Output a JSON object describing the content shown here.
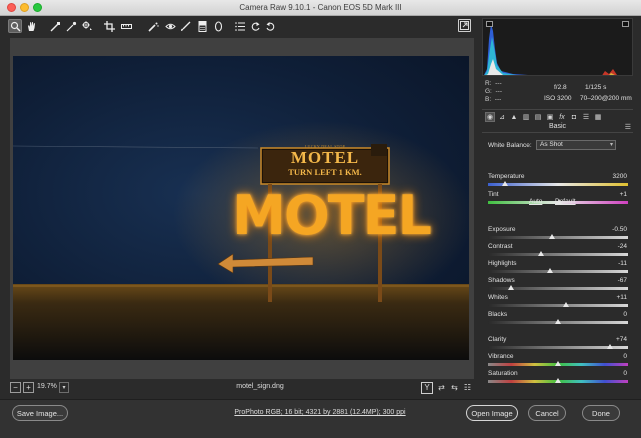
{
  "window": {
    "title": "Camera Raw 9.10.1  -  Canon EOS 5D Mark III"
  },
  "toolbar": {
    "tools": [
      "zoom-tool-icon",
      "hand-tool-icon",
      "white-balance-tool-icon",
      "color-sampler-icon",
      "targeted-adjustment-icon",
      "crop-tool-icon",
      "straighten-tool-icon",
      "spot-removal-icon",
      "red-eye-removal-icon",
      "adjustment-brush-icon",
      "graduated-filter-icon",
      "radial-filter-icon",
      "preferences-icon",
      "rotate-left-icon",
      "rotate-right-icon"
    ],
    "fullscreen_icon": "fullscreen-icon"
  },
  "histogram": {
    "r_label": "R:",
    "r_value": "---",
    "g_label": "G:",
    "g_value": "---",
    "b_label": "B:",
    "b_value": "---",
    "aperture": "f/2.8",
    "shutter": "1/125 s",
    "iso": "ISO 3200",
    "lens": "70–200@200 mm"
  },
  "panel": {
    "title": "Basic",
    "white_balance_label": "White Balance:",
    "white_balance_value": "As Shot",
    "auto_label": "Auto",
    "default_label": "Default"
  },
  "sliders": [
    {
      "label": "Temperature",
      "value": "3200",
      "pos": 0.12
    },
    {
      "label": "Tint",
      "value": "+1",
      "pos": 0.505
    },
    {
      "label": "Exposure",
      "value": "-0.50",
      "pos": 0.46
    },
    {
      "label": "Contrast",
      "value": "-24",
      "pos": 0.38
    },
    {
      "label": "Highlights",
      "value": "-11",
      "pos": 0.445
    },
    {
      "label": "Shadows",
      "value": "-67",
      "pos": 0.165
    },
    {
      "label": "Whites",
      "value": "+11",
      "pos": 0.555
    },
    {
      "label": "Blacks",
      "value": "0",
      "pos": 0.5
    },
    {
      "label": "Clarity",
      "value": "+74",
      "pos": 0.87
    },
    {
      "label": "Vibrance",
      "value": "0",
      "pos": 0.5
    },
    {
      "label": "Saturation",
      "value": "0",
      "pos": 0.5
    }
  ],
  "image": {
    "sign_top": "MOTEL",
    "sign_sub": "TURN LEFT 1 KM.",
    "sign_big": "MOTEL",
    "sign_top_text": "LUCKY DEAL STOP"
  },
  "status": {
    "zoom": "19.7%",
    "filename": "motel_sign.dng",
    "before_after_label": "Y"
  },
  "bottom": {
    "save_label": "Save Image...",
    "workflow": "ProPhoto RGB; 16 bit; 4321 by 2881 (12.4MP); 300 ppi",
    "open_label": "Open Image",
    "cancel_label": "Cancel",
    "done_label": "Done"
  },
  "colors": {
    "sign_glow": "#f0a020",
    "sky": "#0f1f38",
    "accent": "#e8e8e8"
  }
}
